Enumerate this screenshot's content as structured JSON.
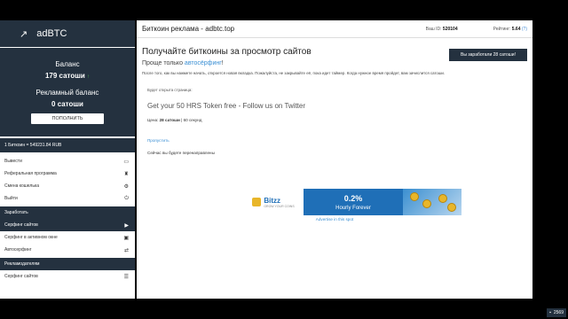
{
  "sidebar": {
    "logo_arrow": "↗",
    "brand": "adBTC",
    "balance_label": "Баланс",
    "balance_value": "179 сатоши",
    "balance_arrow": "↑",
    "ad_balance_label": "Рекламный баланс",
    "ad_balance_value": "0 сатоши",
    "topup_label": "ПОПОЛНИТЬ",
    "rate": "1 Биткоин = 549231.84 RUB",
    "menu": [
      {
        "label": "Вывести",
        "icon": "card-icon"
      },
      {
        "label": "Реферальная программа",
        "icon": "trophy-icon"
      },
      {
        "label": "Смена кошелька",
        "icon": "gear-icon"
      },
      {
        "label": "Выйти",
        "icon": "power-icon"
      }
    ],
    "earn_section": "Заработать",
    "earn_items": [
      {
        "label": "Серфинг сайтов",
        "icon": "play-icon",
        "active": true
      },
      {
        "label": "Серфинг в активном окне",
        "icon": "window-icon"
      },
      {
        "label": "Автосерфинг",
        "icon": "repeat-icon"
      }
    ],
    "advertiser_section": "Рекламодателям",
    "advertiser_items": [
      {
        "label": "Серфинг сайтов",
        "icon": "list-icon"
      }
    ]
  },
  "header": {
    "title": "Биткоин реклама - adbtc.top",
    "id_label": "Ваш ID:",
    "id_value": "520104",
    "rating_label": "Рейтинг:",
    "rating_value": "5.64",
    "rating_link": "(?)"
  },
  "main": {
    "heading": "Получайте биткоины за просмотр сайтов",
    "subheading_prefix": "Проще только ",
    "subheading_link": "автосёрфинг",
    "subheading_suffix": "!",
    "earned_button": "Вы заработали 28 сатоши!",
    "note": "После того, как вы нажмете начать, откроется новая вкладка. Пожалуйста, не закрывайте её, пока идет таймер. Когда нужное время пройдет, вам зачислится сатоши.",
    "will_open": "Будет открыта страница:",
    "site_title": "Get your 50 HRS Token free - Follow us on Twitter",
    "price_label": "Цена:",
    "price_value": "28 сатоши",
    "price_time": "| 60 секунд",
    "skip": "Пропустить",
    "redirect": "Сейчас вы будете перенаправлены",
    "ad_link": "Advertise in this spot"
  },
  "banner": {
    "brand": "Bitzz",
    "tagline": "GROW YOUR COINS",
    "percent": "0.2%",
    "hourly": "Hourly Forever"
  },
  "badge": {
    "count": "2569"
  },
  "colors": {
    "navy": "#24313f",
    "link": "#3a8fd4",
    "banner_blue": "#1f6fb7"
  }
}
